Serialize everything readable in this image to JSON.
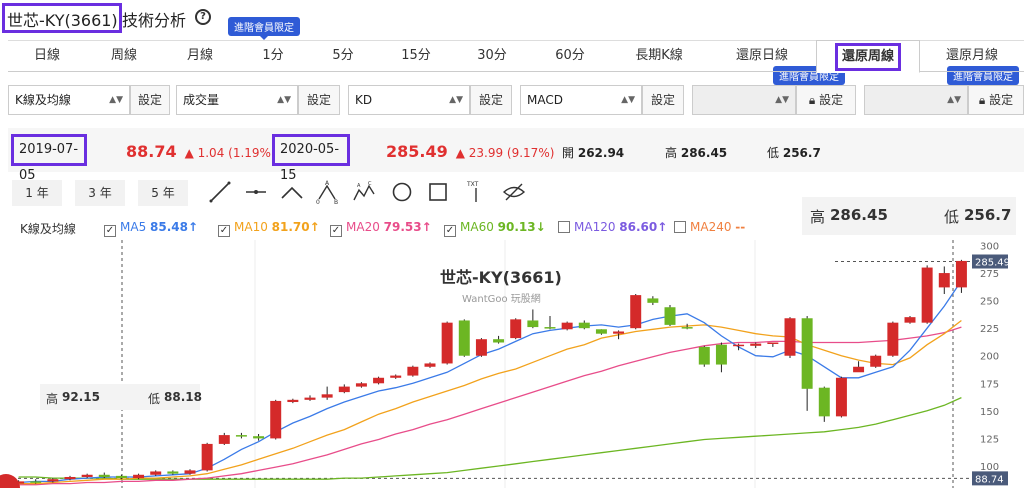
{
  "title": {
    "stock": "世芯-KY(3661)",
    "suffix": "技術分析",
    "help": "?"
  },
  "member_tag": "進階會員限定",
  "tabs": [
    "日線",
    "周線",
    "月線",
    "1分",
    "5分",
    "15分",
    "30分",
    "60分",
    "長期K線",
    "還原日線",
    "還原周線",
    "還原月線"
  ],
  "active_tab": "還原周線",
  "selects": [
    {
      "value": "K線及均線",
      "set": "設定"
    },
    {
      "value": "成交量",
      "set": "設定"
    },
    {
      "value": "KD",
      "set": "設定"
    },
    {
      "value": "MACD",
      "set": "設定"
    },
    {
      "value": "",
      "set": "設定"
    },
    {
      "value": "",
      "set": "設定"
    }
  ],
  "info": {
    "start_date": "2019-07-05",
    "start_price": "88.74",
    "start_change": "1.04 (1.19%)",
    "end_date": "2020-05-15",
    "end_price": "285.49",
    "end_change": "23.99 (9.17%)",
    "open_label": "開",
    "open": "262.94",
    "high_label": "高",
    "high": "286.45",
    "low_label": "低",
    "low": "256.7"
  },
  "ranges": [
    "1 年",
    "3 年",
    "5 年"
  ],
  "tools": [
    "line-tool-icon",
    "horizontal-line-tool-icon",
    "angle-tool-icon",
    "abc-pattern-tool-icon",
    "abcd-pattern-tool-icon",
    "circle-tool-icon",
    "rectangle-tool-icon",
    "text-tool-icon",
    "hide-drawings-icon"
  ],
  "text_tool_label": "TXT",
  "legend": {
    "main": "K線及均線",
    "items": [
      {
        "label": "MA5",
        "value": "85.48↑",
        "color": "#3b7be8",
        "checked": true
      },
      {
        "label": "MA10",
        "value": "81.70↑",
        "color": "#f2a21c",
        "checked": true
      },
      {
        "label": "MA20",
        "value": "79.53↑",
        "color": "#e84d8a",
        "checked": true
      },
      {
        "label": "MA60",
        "value": "90.13↓",
        "color": "#6cb623",
        "checked": true
      },
      {
        "label": "MA120",
        "value": "86.60↑",
        "color": "#7b5be0",
        "checked": false
      },
      {
        "label": "MA240",
        "value": "--",
        "color": "#f08040",
        "checked": false
      }
    ]
  },
  "hover_box": {
    "high_label": "高",
    "high": "286.45",
    "low_label": "低",
    "low": "256.7"
  },
  "hover_box2": {
    "high_label": "高",
    "high": "92.15",
    "low_label": "低",
    "low": "88.18"
  },
  "watermark": {
    "title": "世芯-KY(3661)",
    "sub": "WantGoo 玩股網"
  },
  "colors": {
    "up": "#d42a2a",
    "down": "#6cb623",
    "accent": "#6a2ee0"
  },
  "chart_data": {
    "type": "candlestick",
    "y_ticks": [
      100,
      125,
      150,
      175,
      200,
      225,
      250,
      275,
      300
    ],
    "ylim": [
      80,
      305
    ],
    "last_price_flag": "285.49",
    "start_price_flag": "88.74",
    "candles": [
      [
        84,
        86,
        83,
        87
      ],
      [
        86,
        85,
        84,
        88
      ],
      [
        86,
        88,
        85,
        89
      ],
      [
        88,
        90,
        87,
        91
      ],
      [
        90,
        92,
        89,
        93
      ],
      [
        92,
        90,
        89,
        94
      ],
      [
        91,
        89,
        88,
        92
      ],
      [
        89,
        92,
        88,
        93
      ],
      [
        92,
        95,
        91,
        96
      ],
      [
        95,
        93,
        92,
        96
      ],
      [
        93,
        96,
        92,
        97
      ],
      [
        96,
        120,
        95,
        121
      ],
      [
        120,
        128,
        119,
        130
      ],
      [
        128,
        127,
        125,
        130
      ],
      [
        127,
        125,
        123,
        129
      ],
      [
        125,
        159,
        124,
        160
      ],
      [
        158,
        160,
        157,
        161
      ],
      [
        160,
        162,
        159,
        164
      ],
      [
        162,
        165,
        160,
        172
      ],
      [
        167,
        172,
        166,
        174
      ],
      [
        172,
        175,
        171,
        176
      ],
      [
        175,
        180,
        174,
        181
      ],
      [
        180,
        182,
        179,
        183
      ],
      [
        182,
        190,
        181,
        191
      ],
      [
        190,
        193,
        189,
        194
      ],
      [
        193,
        230,
        192,
        231
      ],
      [
        232,
        200,
        199,
        233
      ],
      [
        200,
        215,
        199,
        216
      ],
      [
        215,
        212,
        211,
        218
      ],
      [
        216,
        233,
        215,
        234
      ],
      [
        232,
        226,
        225,
        242
      ],
      [
        226,
        225,
        224,
        236
      ],
      [
        224,
        230,
        223,
        231
      ],
      [
        230,
        225,
        224,
        232
      ],
      [
        224,
        220,
        219,
        224
      ],
      [
        220,
        222,
        215,
        223
      ],
      [
        225,
        255,
        224,
        256
      ],
      [
        252,
        248,
        246,
        254
      ],
      [
        244,
        228,
        227,
        246
      ],
      [
        226,
        225,
        224,
        229
      ],
      [
        208,
        192,
        190,
        209
      ],
      [
        210,
        192,
        185,
        212
      ],
      [
        210,
        210,
        205,
        211
      ],
      [
        209,
        211,
        207,
        212
      ],
      [
        212,
        212,
        208,
        212
      ],
      [
        200,
        234,
        198,
        235
      ],
      [
        234,
        170,
        150,
        236
      ],
      [
        171,
        145,
        140,
        172
      ],
      [
        145,
        180,
        144,
        181
      ],
      [
        185,
        190,
        188,
        195
      ],
      [
        190,
        200,
        189,
        201
      ],
      [
        200,
        230,
        199,
        231
      ],
      [
        230,
        235,
        229,
        236
      ],
      [
        230,
        280,
        229,
        282
      ],
      [
        262,
        275,
        256,
        281
      ],
      [
        262,
        286,
        257,
        287
      ]
    ],
    "ma5": [
      85,
      86,
      86,
      88,
      89,
      90,
      90,
      90,
      91,
      92,
      93,
      98,
      106,
      115,
      122,
      131,
      139,
      145,
      152,
      158,
      163,
      168,
      171,
      175,
      180,
      185,
      193,
      201,
      206,
      213,
      220,
      223,
      225,
      227,
      228,
      226,
      228,
      233,
      236,
      238,
      230,
      218,
      208,
      200,
      199,
      205,
      200,
      190,
      180,
      180,
      185,
      190,
      205,
      225,
      245,
      268
    ],
    "ma10": [
      84,
      84,
      85,
      86,
      87,
      88,
      88,
      89,
      89,
      90,
      91,
      93,
      97,
      101,
      106,
      111,
      116,
      122,
      128,
      133,
      140,
      147,
      152,
      158,
      163,
      168,
      173,
      179,
      184,
      188,
      194,
      200,
      206,
      210,
      216,
      219,
      222,
      224,
      226,
      227,
      228,
      226,
      223,
      220,
      218,
      217,
      210,
      205,
      200,
      196,
      193,
      192,
      198,
      210,
      220,
      232
    ],
    "ma20": [
      83,
      83,
      84,
      84,
      85,
      85,
      86,
      86,
      87,
      87,
      88,
      89,
      91,
      93,
      96,
      99,
      102,
      106,
      110,
      115,
      120,
      124,
      129,
      133,
      138,
      142,
      147,
      152,
      157,
      162,
      167,
      172,
      177,
      182,
      186,
      191,
      195,
      199,
      203,
      206,
      209,
      211,
      212,
      212,
      213,
      213,
      212,
      212,
      212,
      212,
      213,
      214,
      216,
      218,
      221,
      226
    ],
    "ma60": [
      90,
      90,
      89,
      89,
      89,
      89,
      88,
      88,
      88,
      88,
      88,
      88,
      88,
      88,
      88,
      88,
      88,
      88,
      88,
      89,
      89,
      90,
      91,
      92,
      93,
      94,
      96,
      98,
      100,
      102,
      104,
      106,
      108,
      110,
      112,
      114,
      116,
      118,
      120,
      122,
      124,
      125,
      126,
      127,
      128,
      129,
      130,
      131,
      133,
      135,
      138,
      142,
      146,
      150,
      155,
      162
    ]
  }
}
